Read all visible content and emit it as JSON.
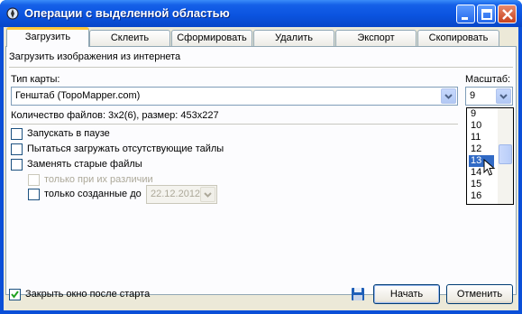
{
  "window": {
    "title": "Операции с выделенной областью"
  },
  "tabs": [
    {
      "label": "Загрузить",
      "active": true
    },
    {
      "label": "Склеить"
    },
    {
      "label": "Сформировать"
    },
    {
      "label": "Удалить"
    },
    {
      "label": "Экспорт"
    },
    {
      "label": "Скопировать"
    }
  ],
  "load_tab": {
    "heading": "Загрузить изображения из интернета",
    "map_type_label": "Тип карты:",
    "map_type_value": "Генштаб (TopoMapper.com)",
    "scale_label": "Масштаб:",
    "scale_value": "9",
    "scale_options": [
      "9",
      "10",
      "11",
      "12",
      "13",
      "14",
      "15",
      "16"
    ],
    "scale_highlighted": "13",
    "files_info": "Количество файлов: 3x2(6), размер: 453x227",
    "options": {
      "start_paused": "Запускать в паузе",
      "try_missing": "Пытаться загружать отсутствующие тайлы",
      "replace_old": "Заменять старые файлы",
      "only_diff": "только при их различии",
      "only_created_before": "только созданные до",
      "date_value": "22.12.2012"
    }
  },
  "footer": {
    "close_after_start": "Закрыть окно после старта",
    "close_after_start_checked": true,
    "start_button": "Начать",
    "cancel_button": "Отменить"
  },
  "colors": {
    "titlebar": "#0b54e0",
    "selection": "#316ac5",
    "active_tab_accent": "#ffc83c"
  }
}
